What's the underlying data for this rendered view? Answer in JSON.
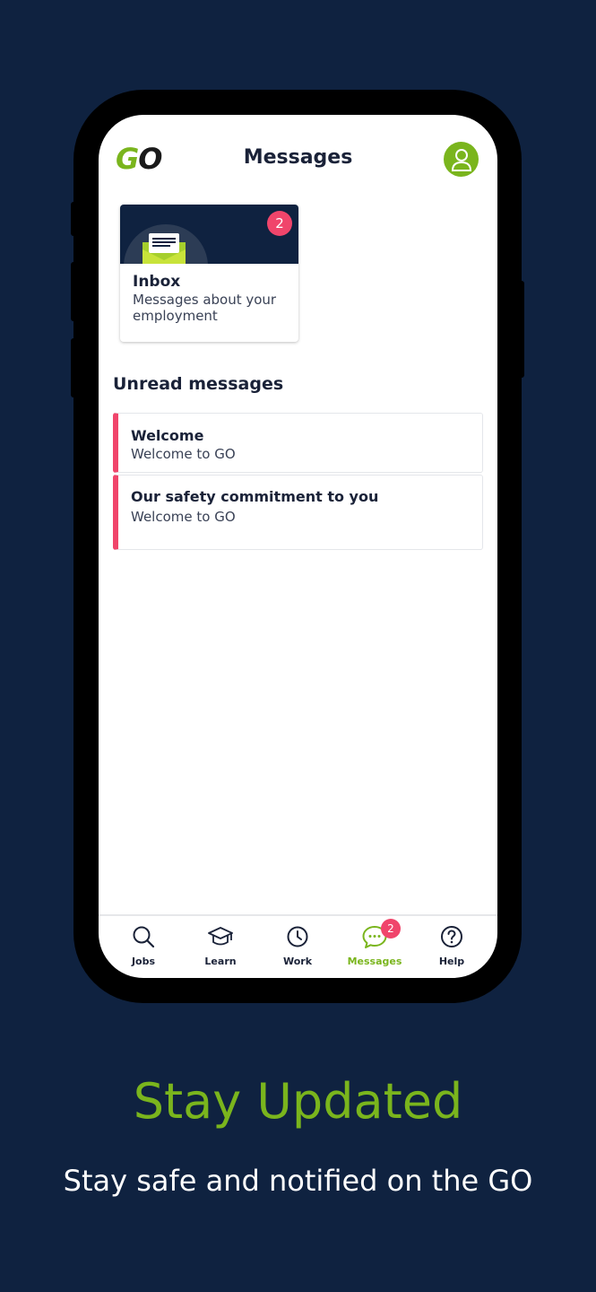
{
  "colors": {
    "background": "#0f2240",
    "brand_green": "#7ab51d",
    "badge_pink": "#f0456b",
    "text_dark": "#1a2238"
  },
  "header": {
    "logo_g": "G",
    "logo_o": "O",
    "title": "Messages",
    "profile_icon": "user-icon"
  },
  "inbox": {
    "badge_count": "2",
    "title": "Inbox",
    "description": "Messages about your employment",
    "icon": "envelope-icon"
  },
  "unread": {
    "section_title": "Unread messages",
    "messages": [
      {
        "title": "Welcome",
        "subtitle": "Welcome to GO"
      },
      {
        "title": "Our safety commitment to you",
        "subtitle": "Welcome to GO"
      }
    ]
  },
  "tabs": [
    {
      "label": "Jobs",
      "icon": "search-icon"
    },
    {
      "label": "Learn",
      "icon": "graduation-cap-icon"
    },
    {
      "label": "Work",
      "icon": "clock-icon"
    },
    {
      "label": "Messages",
      "icon": "chat-bubble-icon",
      "badge": "2",
      "active": true
    },
    {
      "label": "Help",
      "icon": "question-circle-icon"
    }
  ],
  "promo": {
    "title": "Stay Updated",
    "subtitle": "Stay safe and notified on the GO"
  }
}
